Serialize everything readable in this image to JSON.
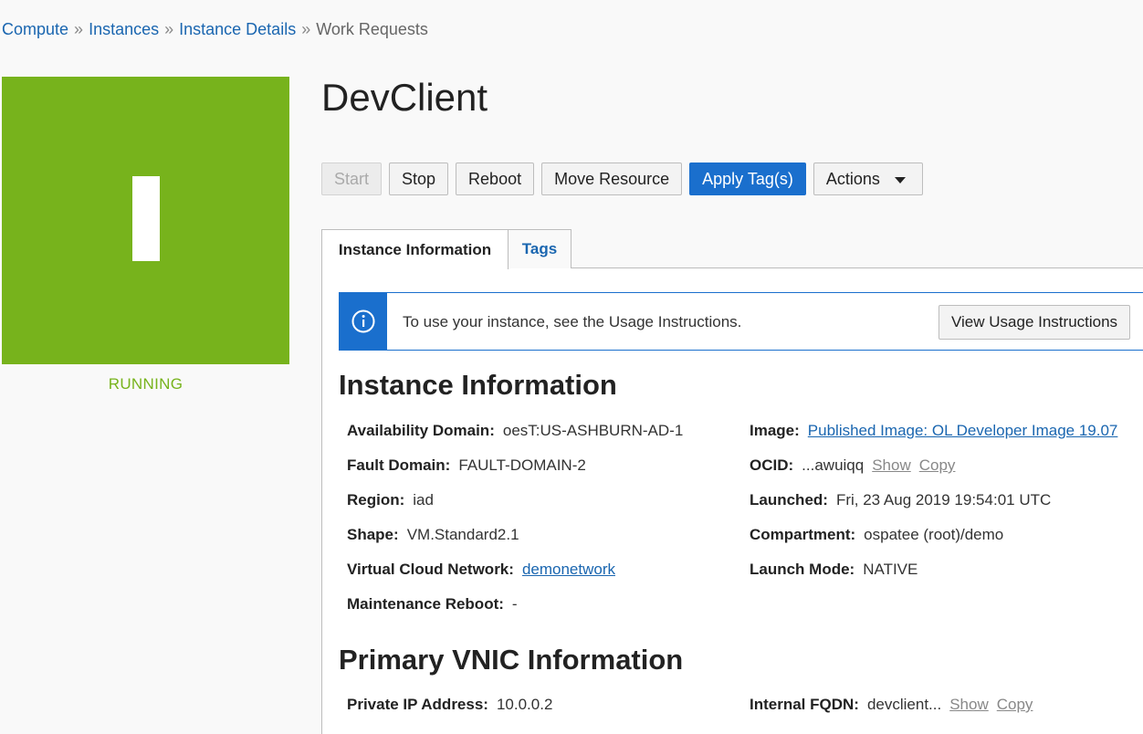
{
  "breadcrumb": {
    "items": [
      "Compute",
      "Instances",
      "Instance Details"
    ],
    "current": "Work Requests",
    "separator": "»"
  },
  "status": {
    "label": "RUNNING",
    "glyph": "I",
    "color": "#77b31c"
  },
  "instance": {
    "name": "DevClient"
  },
  "toolbar": {
    "start": "Start",
    "stop": "Stop",
    "reboot": "Reboot",
    "move": "Move Resource",
    "apply_tags": "Apply Tag(s)",
    "actions": "Actions"
  },
  "tabs": [
    {
      "label": "Instance Information",
      "active": true
    },
    {
      "label": "Tags",
      "active": false
    }
  ],
  "banner": {
    "icon": "info-icon",
    "text": "To use your instance, see the Usage Instructions.",
    "button": "View Usage Instructions"
  },
  "instance_info": {
    "heading": "Instance Information",
    "availability_domain": {
      "label": "Availability Domain:",
      "value": "oesT:US-ASHBURN-AD-1"
    },
    "fault_domain": {
      "label": "Fault Domain:",
      "value": "FAULT-DOMAIN-2"
    },
    "region": {
      "label": "Region:",
      "value": "iad"
    },
    "shape": {
      "label": "Shape:",
      "value": "VM.Standard2.1"
    },
    "vcn": {
      "label": "Virtual Cloud Network:",
      "value": "demonetwork"
    },
    "maintenance_reboot": {
      "label": "Maintenance Reboot:",
      "value": "-"
    },
    "image": {
      "label": "Image:",
      "value": "Published Image: OL Developer Image 19.07"
    },
    "ocid": {
      "label": "OCID:",
      "value": "...awuiqq",
      "show": "Show",
      "copy": "Copy"
    },
    "launched": {
      "label": "Launched:",
      "value": "Fri, 23 Aug 2019 19:54:01 UTC"
    },
    "compartment": {
      "label": "Compartment:",
      "value": "ospatee (root)/demo"
    },
    "launch_mode": {
      "label": "Launch Mode:",
      "value": "NATIVE"
    }
  },
  "vnic_info": {
    "heading": "Primary VNIC Information",
    "private_ip": {
      "label": "Private IP Address:",
      "value": "10.0.0.2"
    },
    "internal_fqdn": {
      "label": "Internal FQDN:",
      "value": "devclient...",
      "show": "Show",
      "copy": "Copy"
    }
  },
  "colors": {
    "accent": "#1a6fcd",
    "link": "#1a66b0",
    "running": "#77b31c"
  }
}
